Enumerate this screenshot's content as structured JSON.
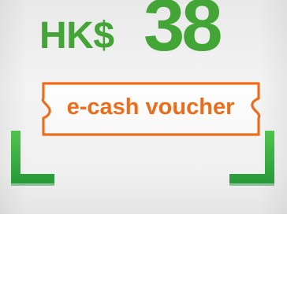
{
  "voucher": {
    "currency": "HK$",
    "amount": "38",
    "label": "e-cash voucher"
  },
  "colors": {
    "amount_green": "#43a535",
    "label_orange": "#ed6c1a",
    "corner_green": "#3cb33f",
    "corner_shadow": "#17852f"
  }
}
